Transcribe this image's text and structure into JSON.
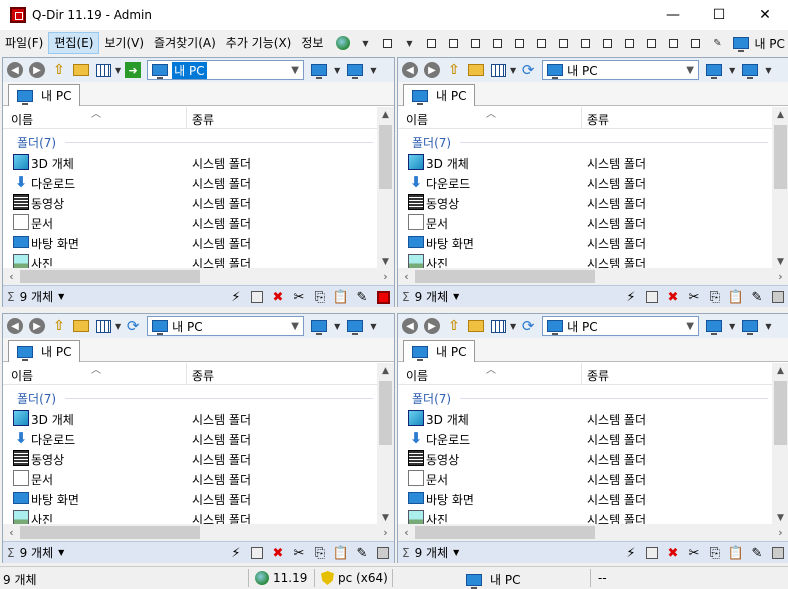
{
  "window": {
    "title": "Q-Dir 11.19 - Admin",
    "min": "—",
    "max": "☐",
    "close": "✕"
  },
  "menu": {
    "items": [
      "파일(F)",
      "편집(E)",
      "보기(V)",
      "즐겨찾기(A)",
      "추가 기능(X)",
      "정보"
    ],
    "active": "편집(E)",
    "right_label": "내 PC"
  },
  "panes": [
    {
      "address": "내 PC",
      "address_selected": true,
      "go_icon": "green-go-arrow-icon",
      "tab": "내 PC",
      "columns": {
        "name": "이름",
        "type": "종류"
      },
      "group": "폴더(7)",
      "rows": [
        {
          "name": "3D 개체",
          "type": "시스템 폴더",
          "icon": "3d-objects-icon"
        },
        {
          "name": "다운로드",
          "type": "시스템 폴더",
          "icon": "downloads-icon"
        },
        {
          "name": "동영상",
          "type": "시스템 폴더",
          "icon": "videos-icon"
        },
        {
          "name": "문서",
          "type": "시스템 폴더",
          "icon": "documents-icon"
        },
        {
          "name": "바탕 화면",
          "type": "시스템 폴더",
          "icon": "desktop-icon"
        },
        {
          "name": "사진",
          "type": "시스템 폴더",
          "icon": "pictures-icon"
        }
      ],
      "count": "9 개체",
      "active_indicator": "red"
    },
    {
      "address": "내 PC",
      "address_selected": false,
      "go_icon": "refresh-icon",
      "tab": "내 PC",
      "columns": {
        "name": "이름",
        "type": "종류"
      },
      "group": "폴더(7)",
      "rows": [
        {
          "name": "3D 개체",
          "type": "시스템 폴더",
          "icon": "3d-objects-icon"
        },
        {
          "name": "다운로드",
          "type": "시스템 폴더",
          "icon": "downloads-icon"
        },
        {
          "name": "동영상",
          "type": "시스템 폴더",
          "icon": "videos-icon"
        },
        {
          "name": "문서",
          "type": "시스템 폴더",
          "icon": "documents-icon"
        },
        {
          "name": "바탕 화면",
          "type": "시스템 폴더",
          "icon": "desktop-icon"
        },
        {
          "name": "사진",
          "type": "시스템 폴더",
          "icon": "pictures-icon"
        }
      ],
      "count": "9 개체",
      "active_indicator": "gray"
    },
    {
      "address": "내 PC",
      "address_selected": false,
      "go_icon": "refresh-icon",
      "tab": "내 PC",
      "columns": {
        "name": "이름",
        "type": "종류"
      },
      "group": "폴더(7)",
      "rows": [
        {
          "name": "3D 개체",
          "type": "시스템 폴더",
          "icon": "3d-objects-icon"
        },
        {
          "name": "다운로드",
          "type": "시스템 폴더",
          "icon": "downloads-icon"
        },
        {
          "name": "동영상",
          "type": "시스템 폴더",
          "icon": "videos-icon"
        },
        {
          "name": "문서",
          "type": "시스템 폴더",
          "icon": "documents-icon"
        },
        {
          "name": "바탕 화면",
          "type": "시스템 폴더",
          "icon": "desktop-icon"
        },
        {
          "name": "사진",
          "type": "시스템 폴더",
          "icon": "pictures-icon"
        }
      ],
      "count": "9 개체",
      "active_indicator": "gray"
    },
    {
      "address": "내 PC",
      "address_selected": false,
      "go_icon": "refresh-icon",
      "tab": "내 PC",
      "columns": {
        "name": "이름",
        "type": "종류"
      },
      "group": "폴더(7)",
      "rows": [
        {
          "name": "3D 개체",
          "type": "시스템 폴더",
          "icon": "3d-objects-icon"
        },
        {
          "name": "다운로드",
          "type": "시스템 폴더",
          "icon": "downloads-icon"
        },
        {
          "name": "동영상",
          "type": "시스템 폴더",
          "icon": "videos-icon"
        },
        {
          "name": "문서",
          "type": "시스템 폴더",
          "icon": "documents-icon"
        },
        {
          "name": "바탕 화면",
          "type": "시스템 폴더",
          "icon": "desktop-icon"
        },
        {
          "name": "사진",
          "type": "시스템 폴더",
          "icon": "pictures-icon"
        }
      ],
      "count": "9 개체",
      "active_indicator": "gray"
    }
  ],
  "statusbar": {
    "count": "9 개체",
    "version": "11.19",
    "arch": "pc (x64)",
    "location": "내 PC",
    "extra": "--"
  },
  "colors": {
    "accent": "#0078d7",
    "group_text": "#2d5fb0",
    "delete_red": "#dd0000"
  }
}
